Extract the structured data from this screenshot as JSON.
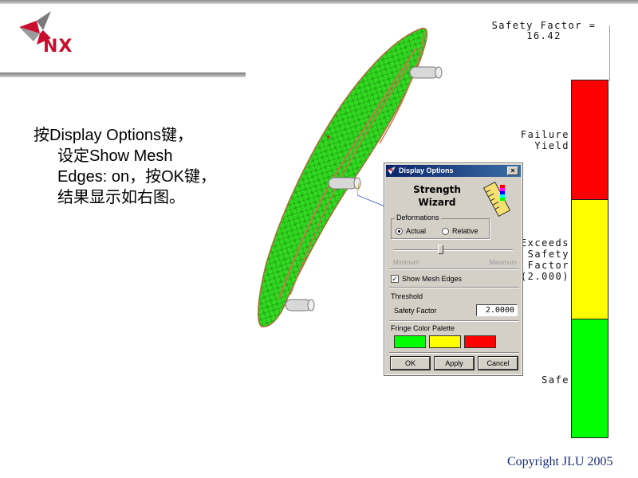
{
  "slide": {
    "logo_text": "NX",
    "bullet_lines": [
      "按Display Options键，",
      "设定Show Mesh",
      "Edges: on，按OK键，",
      "结果显示如右图。"
    ],
    "copyright": "Copyright JLU 2005"
  },
  "legend": {
    "safety_factor_title": "Safety Factor =",
    "safety_factor_value": "16.42",
    "failure_label_1": "Failure",
    "failure_label_2": "Yield",
    "exceeds_label_1": "Exceeds",
    "exceeds_label_2": "Safety",
    "exceeds_label_3": "Factor",
    "exceeds_label_4": "(2.000)",
    "safe_label": "Safe",
    "colors": {
      "red": "#ff0000",
      "yellow": "#ffff00",
      "green": "#00ff00"
    }
  },
  "dialog": {
    "title": "Display Options",
    "close_glyph": "×",
    "wizard_title_1": "Strength",
    "wizard_title_2": "Wizard",
    "deformations": {
      "label": "Deformations",
      "options": [
        "Actual",
        "Relative"
      ],
      "selected": "Actual"
    },
    "slider": {
      "min_label": "Minimum",
      "max_label": "Maximum"
    },
    "show_mesh_edges": {
      "label": "Show Mesh Edges",
      "checked": true,
      "check_glyph": "✓"
    },
    "threshold": {
      "label": "Threshold",
      "safety_factor_label": "Safety Factor",
      "safety_factor_value": "2.0000"
    },
    "fringe_palette": {
      "label": "Fringe Color Palette",
      "colors": [
        "#00ff00",
        "#ffff00",
        "#ff0000"
      ]
    },
    "buttons": {
      "ok": "OK",
      "apply": "Apply",
      "cancel": "Cancel"
    }
  }
}
